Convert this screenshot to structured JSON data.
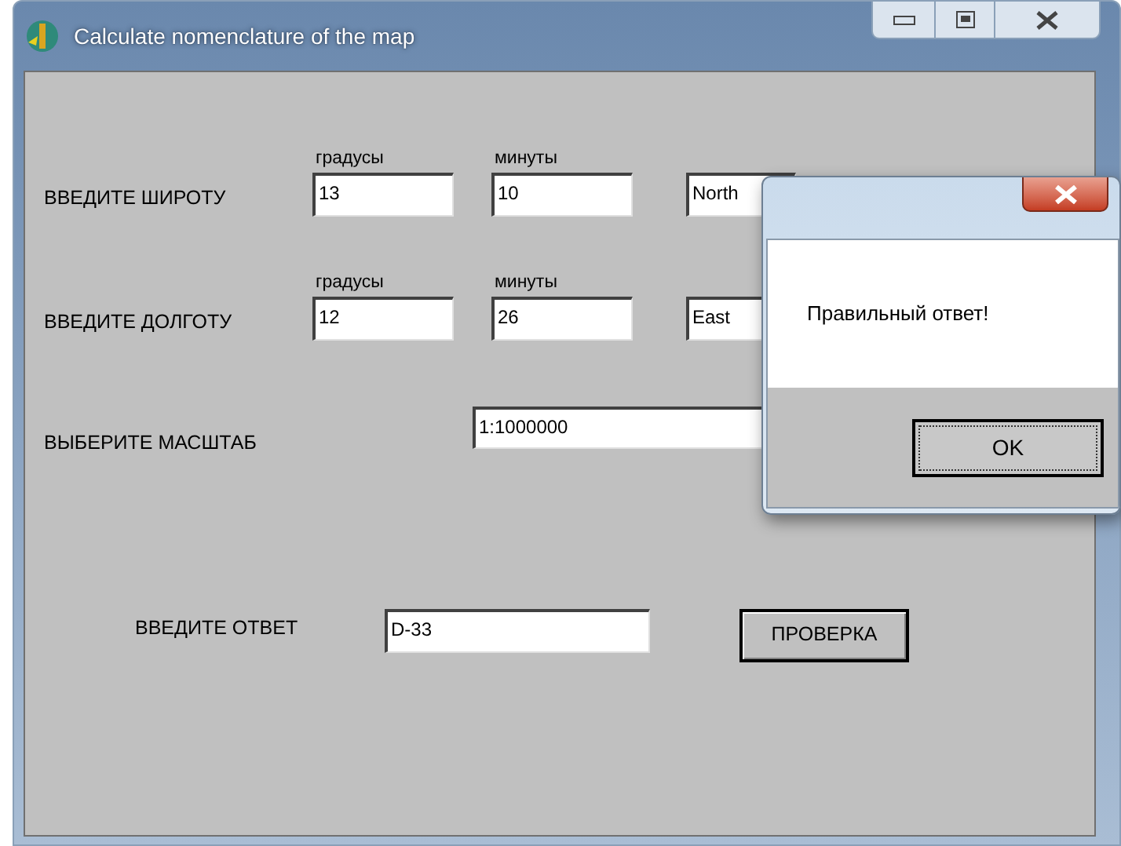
{
  "window": {
    "title": "Calculate nomenclature of the map"
  },
  "coordinates": [
    {
      "label": "ВВЕДИТЕ ШИРОТУ",
      "degrees_caption": "градусы",
      "degrees": "13",
      "minutes_caption": "минуты",
      "minutes": "10",
      "hemisphere": "North"
    },
    {
      "label": "ВВЕДИТЕ ДОЛГОТУ",
      "degrees_caption": "градусы",
      "degrees": "12",
      "minutes_caption": "минуты",
      "minutes": "26",
      "hemisphere": "East"
    }
  ],
  "scale": {
    "label": "ВЫБЕРИТЕ МАСШТАБ",
    "value": "1:1000000"
  },
  "answer": {
    "label": "ВВЕДИТЕ ОТВЕТ",
    "value": "D-33"
  },
  "check_button": "ПРОВЕРКА",
  "dialog": {
    "message": "Правильный ответ!",
    "button": "OK"
  }
}
